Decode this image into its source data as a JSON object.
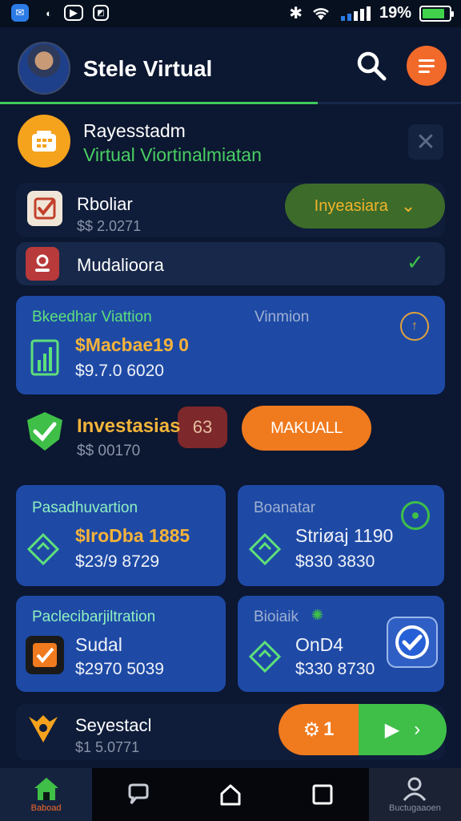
{
  "status_bar": {
    "battery_text": "19%",
    "battery_level": 0.19,
    "left_icons": [
      "app-icon-1",
      "app-icon-2",
      "app-icon-3",
      "app-icon-4"
    ],
    "right_icons": [
      "bluetooth-icon",
      "wifi-icon",
      "signal-icon",
      "battery-icon"
    ]
  },
  "header": {
    "title": "Stele Virtual",
    "progress": 0.69,
    "accent": "#f26a2a",
    "progress_color": "#40c95a"
  },
  "notification": {
    "title": "Rayesstadm",
    "subtitle": "Virtual Viortinalmiatan"
  },
  "rows": {
    "first": {
      "title": "Rboliar",
      "subtitle": "$$ 2.0271",
      "action_label": "Inyeasiara"
    },
    "second": {
      "title": "Mudalioora"
    }
  },
  "featured_card": {
    "label": "Bkeedhar Viattion",
    "value_primary": "$Macbae19 0",
    "value_secondary": "$9.7.0 6020",
    "right_label": "Vinmion"
  },
  "investments": {
    "title": "Investasias",
    "badge": "63",
    "subtitle": "$$ 00170",
    "manual_button": "MAKUALL"
  },
  "grid_cards": [
    {
      "label": "Pasadhuvartion",
      "value_primary": "$IroDba 1885",
      "value_secondary": "$23/9 8729"
    },
    {
      "label": "Boanatar",
      "value_primary": "Striøaj 1190",
      "value_secondary": "$830 3830"
    },
    {
      "label": "Paclecibarjiltration",
      "value_primary": "Sudal",
      "value_secondary": "$2970 5039"
    },
    {
      "label": "Bioiaik",
      "value_primary": "OnD4",
      "value_secondary": "$330 8730"
    }
  ],
  "bottom_item": {
    "title": "Seyestacl",
    "subtitle": "$1 5.0771"
  },
  "fab": {
    "count": "1"
  },
  "nav": {
    "home_label": "Baboad",
    "profile_label": "Buctugaaoen"
  }
}
